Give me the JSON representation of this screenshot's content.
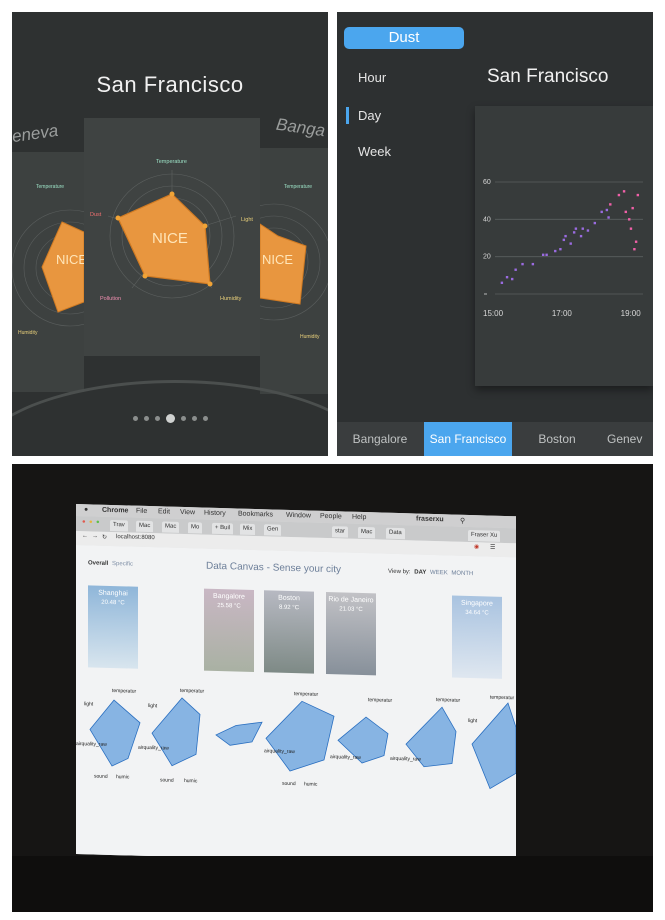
{
  "panel_carousel": {
    "city_title": "San Francisco",
    "left_city": "eneva",
    "right_city": "Banga",
    "center_radar": {
      "badge": "NICE",
      "axes": [
        "Temperature",
        "Light",
        "Humidity",
        "Pollution",
        "Dust"
      ]
    },
    "left_radar": {
      "badge": "NICE",
      "axes": [
        "Temperature",
        "Humidity"
      ]
    },
    "right_radar": {
      "badge": "NICE",
      "axes": [
        "Temperature",
        "Humidity"
      ]
    },
    "page_dots": {
      "count": 7,
      "active_index": 3
    },
    "colors": {
      "radar_fill": "#e8963f",
      "background": "#2e3131",
      "card": "#3d4140"
    }
  },
  "panel_dust": {
    "metric_label": "Dust",
    "ranges": [
      "Hour",
      "Day",
      "Week"
    ],
    "selected_range": "Day",
    "city_title": "San Francisco",
    "cities": [
      "Bangalore",
      "San Francisco",
      "Boston",
      "Genev"
    ],
    "active_city": "San Francisco",
    "colors": {
      "accent": "#4ba6ee",
      "early_points": "#9a6be0",
      "late_points": "#f060a8"
    }
  },
  "chart_data": {
    "type": "scatter",
    "title": "",
    "xlabel": "",
    "ylabel": "",
    "x_ticks": [
      "15:00",
      "17:00",
      "19:00"
    ],
    "y_ticks": [
      "60",
      "40",
      "20",
      "0"
    ],
    "xlim": [
      15.0,
      19.3
    ],
    "ylim": [
      0,
      60
    ],
    "grid": true,
    "series": [
      {
        "color": "#9a6be0",
        "points": [
          [
            15.2,
            6
          ],
          [
            15.35,
            9
          ],
          [
            15.5,
            8
          ],
          [
            15.6,
            13
          ],
          [
            15.8,
            16
          ],
          [
            16.1,
            16
          ],
          [
            16.4,
            21
          ],
          [
            16.5,
            21
          ],
          [
            16.75,
            23
          ],
          [
            16.9,
            24
          ],
          [
            17.0,
            29
          ],
          [
            17.05,
            31
          ],
          [
            17.2,
            27
          ],
          [
            17.3,
            33
          ],
          [
            17.35,
            35
          ],
          [
            17.5,
            31
          ],
          [
            17.55,
            35
          ],
          [
            17.7,
            34
          ],
          [
            17.9,
            38
          ],
          [
            18.1,
            44
          ],
          [
            18.25,
            45
          ],
          [
            18.3,
            41
          ]
        ]
      },
      {
        "color": "#f060a8",
        "points": [
          [
            18.35,
            48
          ],
          [
            18.6,
            53
          ],
          [
            18.75,
            55
          ],
          [
            18.8,
            44
          ],
          [
            18.9,
            40
          ],
          [
            18.95,
            35
          ],
          [
            19.0,
            46
          ],
          [
            19.05,
            24
          ],
          [
            19.1,
            28
          ],
          [
            19.15,
            53
          ]
        ]
      }
    ]
  },
  "panel_projector": {
    "menu_items": [
      "Chrome",
      "File",
      "Edit",
      "View",
      "History",
      "Bookmarks",
      "Window",
      "People",
      "Help"
    ],
    "user_name": "fraserxu",
    "tabs": [
      "Trav",
      "Mac",
      "Mac",
      "Mo",
      "+ Buil",
      "Mix",
      "Gen",
      "star",
      "Mac",
      "Data"
    ],
    "profile_tab": "Fraser Xu",
    "url": "localhost:8080",
    "app_title": "Data Canvas - Sense your city",
    "overall_label": "Overall",
    "specific_label": "Specific",
    "view_by_label": "View by:",
    "view_by_options": [
      "DAY",
      "WEEK",
      "MONTH"
    ],
    "cities": [
      {
        "name": "Shanghai",
        "temp": "20.48 °C"
      },
      {
        "name": "Bangalore",
        "temp": "25.58 °C"
      },
      {
        "name": "Boston",
        "temp": "8.92 °C"
      },
      {
        "name": "Rio de Janeiro",
        "temp": "21.03 °C"
      },
      {
        "name": "Singapore",
        "temp": "34.64 °C"
      }
    ],
    "radar_axes": [
      "temperatur",
      "light",
      "airquality_raw",
      "sound",
      "humic"
    ],
    "radar_color": "#2f7fd6"
  }
}
